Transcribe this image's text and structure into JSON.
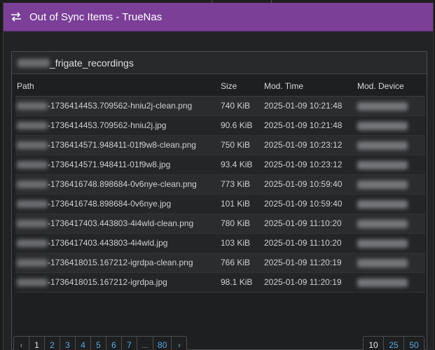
{
  "window": {
    "title": "Out of Sync Items - TrueNas",
    "icon": "sync-arrows-icon",
    "accent": "#7b3f98"
  },
  "panel": {
    "folder_suffix": "_frigate_recordings"
  },
  "table": {
    "headers": [
      "Path",
      "Size",
      "Mod. Time",
      "Mod. Device"
    ],
    "rows": [
      {
        "path": "-1736414453.709562-hniu2j-clean.png",
        "size": "740 KiB",
        "time": "2025-01-09 10:21:48"
      },
      {
        "path": "-1736414453.709562-hniu2j.jpg",
        "size": "90.6 KiB",
        "time": "2025-01-09 10:21:48"
      },
      {
        "path": "-1736414571.948411-01f9w8-clean.png",
        "size": "750 KiB",
        "time": "2025-01-09 10:23:12"
      },
      {
        "path": "-1736414571.948411-01f9w8.jpg",
        "size": "93.4 KiB",
        "time": "2025-01-09 10:23:12"
      },
      {
        "path": "-1736416748.898684-0v6nye-clean.png",
        "size": "773 KiB",
        "time": "2025-01-09 10:59:40"
      },
      {
        "path": "-1736416748.898684-0v6nye.jpg",
        "size": "101 KiB",
        "time": "2025-01-09 10:59:40"
      },
      {
        "path": "-1736417403.443803-4i4wld-clean.png",
        "size": "780 KiB",
        "time": "2025-01-09 11:10:20"
      },
      {
        "path": "-1736417403.443803-4i4wld.jpg",
        "size": "103 KiB",
        "time": "2025-01-09 11:10:20"
      },
      {
        "path": "-1736418015.167212-igrdpa-clean.png",
        "size": "766 KiB",
        "time": "2025-01-09 11:20:19"
      },
      {
        "path": "-1736418015.167212-igrdpa.jpg",
        "size": "98.1 KiB",
        "time": "2025-01-09 11:20:19"
      }
    ]
  },
  "pagination": {
    "prev": "‹",
    "pages": [
      "1",
      "2",
      "3",
      "4",
      "5",
      "6",
      "7"
    ],
    "ellipsis": "...",
    "last": "80",
    "next": "›",
    "current": "1"
  },
  "page_sizes": {
    "options": [
      "10",
      "25",
      "50"
    ],
    "current": "10"
  }
}
